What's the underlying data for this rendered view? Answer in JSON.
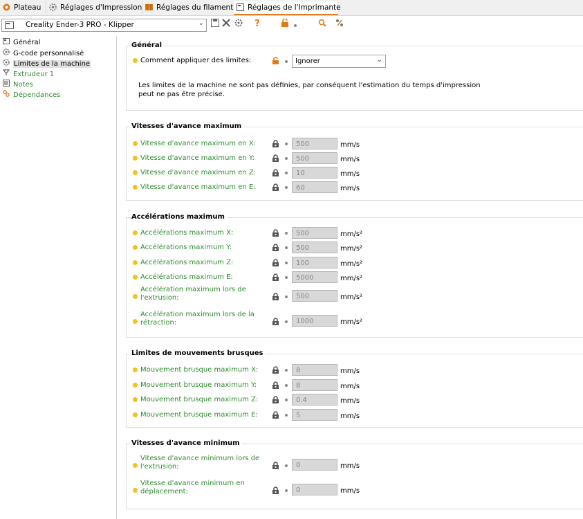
{
  "tabs": [
    {
      "label": "Plateau",
      "icon": "plate-icon"
    },
    {
      "label": "Réglages d'Impression",
      "icon": "print-settings-gear-icon"
    },
    {
      "label": "Réglages du filament",
      "icon": "filament-spool-icon"
    },
    {
      "label": "Réglages de l'Imprimante",
      "icon": "printer-settings-icon"
    }
  ],
  "toolbar": {
    "preset": "Creality Ender-3 PRO - Klipper"
  },
  "sidebar": [
    {
      "label": "Général",
      "color": "#000000"
    },
    {
      "label": "G-code personnalisé",
      "color": "#000000"
    },
    {
      "label": "Limites de la machine",
      "color": "#000000"
    },
    {
      "label": "Extrudeur 1",
      "color": "#2e8b2e"
    },
    {
      "label": "Notes",
      "color": "#2e8b2e"
    },
    {
      "label": "Dépendances",
      "color": "#2e8b2e"
    }
  ],
  "general": {
    "title": "Général",
    "limit_label": "Comment appliquer des limites:",
    "limit_value": "Ignorer",
    "note": "Les limites de la machine ne sont pas définies, par conséquent l'estimation du temps d'impression peut ne pas être précise."
  },
  "sections": [
    {
      "title": "Vitesses d'avance maximum",
      "rows": [
        {
          "label": "Vitesse d'avance maximum en X:",
          "value": "500",
          "unit": "mm/s"
        },
        {
          "label": "Vitesse d'avance maximum en Y:",
          "value": "500",
          "unit": "mm/s"
        },
        {
          "label": "Vitesse d'avance maximum en Z:",
          "value": "10",
          "unit": "mm/s"
        },
        {
          "label": "Vitesse d'avance maximum en E:",
          "value": "60",
          "unit": "mm/s"
        }
      ]
    },
    {
      "title": "Accélérations maximum",
      "rows": [
        {
          "label": "Accélérations maximum X:",
          "value": "500",
          "unit": "mm/s²"
        },
        {
          "label": "Accélérations maximum Y:",
          "value": "500",
          "unit": "mm/s²"
        },
        {
          "label": "Accélérations maximum Z:",
          "value": "100",
          "unit": "mm/s²"
        },
        {
          "label": "Accélérations maximum E:",
          "value": "5000",
          "unit": "mm/s²"
        },
        {
          "label": "Accélération maximum lors de",
          "label2": "l'extrusion:",
          "value": "500",
          "unit": "mm/s²"
        },
        {
          "label": "Accélération maximum lors de la",
          "label2": "rétraction:",
          "value": "1000",
          "unit": "mm/s²"
        }
      ]
    },
    {
      "title": "Limites de mouvements brusques",
      "rows": [
        {
          "label": "Mouvement brusque maximum X:",
          "value": "8",
          "unit": "mm/s"
        },
        {
          "label": "Mouvement brusque maximum Y:",
          "value": "8",
          "unit": "mm/s"
        },
        {
          "label": "Mouvement brusque maximum Z:",
          "value": "0.4",
          "unit": "mm/s"
        },
        {
          "label": "Mouvement brusque maximum E:",
          "value": "5",
          "unit": "mm/s"
        }
      ]
    },
    {
      "title": "Vitesses d'avance minimum",
      "rows": [
        {
          "label": "Vitesse d'avance minimum lors de",
          "label2": "l'extrusion:",
          "value": "0",
          "unit": "mm/s"
        },
        {
          "label": "Vitesse d'avance minimum en",
          "label2": "déplacement:",
          "value": "0",
          "unit": "mm/s"
        }
      ]
    }
  ],
  "colors": {
    "accent": "#e07b1a",
    "modified_label": "#2e8b2e",
    "dot": "#f2c419"
  }
}
